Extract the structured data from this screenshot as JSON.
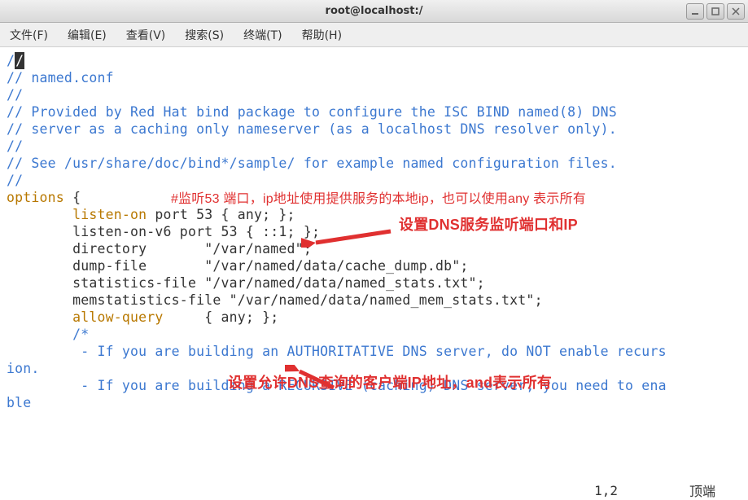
{
  "window": {
    "title": "root@localhost:/"
  },
  "menu": {
    "file": "文件(F)",
    "edit": "编辑(E)",
    "view": "查看(V)",
    "search": "搜索(S)",
    "terminal": "终端(T)",
    "help": "帮助(H)"
  },
  "code": {
    "l1": "//",
    "l2": "// named.conf",
    "l3": "//",
    "l4": "// Provided by Red Hat bind package to configure the ISC BIND named(8) DNS",
    "l5": "// server as a caching only nameserver (as a localhost DNS resolver only).",
    "l6": "//",
    "l7": "// See /usr/share/doc/bind*/sample/ for example named configuration files.",
    "l8": "//",
    "options_kw": "options",
    "brace_open": " {",
    "listen_kw": "        listen-on",
    "listen_rest": " port 53 { any; };",
    "listen_v6": "        listen-on-v6 port 53 { ::1; };",
    "directory": "        directory       \"/var/named\";",
    "dump_file": "        dump-file       \"/var/named/data/cache_dump.db\";",
    "stats_file": "        statistics-file \"/var/named/data/named_stats.txt\";",
    "mem_stats": "        memstatistics-file \"/var/named/data/named_mem_stats.txt\";",
    "allow_kw": "        allow-query",
    "allow_rest": "     { any; };",
    "cm_open": "        /*",
    "cm_l1a": "         - If you are building an AUTHORITATIVE DNS server, do NOT enable recurs",
    "cm_l1b": "ion.",
    "cm_l2a": "         - If you are building a RECURSIVE (caching) DNS server, you need to ena",
    "cm_l2b": "ble"
  },
  "annotations": {
    "top_note": "#监听53 端口，ip地址使用提供服务的本地ip，也可以使用any 表示所有",
    "arrow1_label": "设置DNS服务监听端口和IP",
    "arrow2_label": "设置允许DNS查询的客户端IP地址，and表示所有"
  },
  "status": {
    "position": "1,2",
    "mode": "顶端"
  }
}
